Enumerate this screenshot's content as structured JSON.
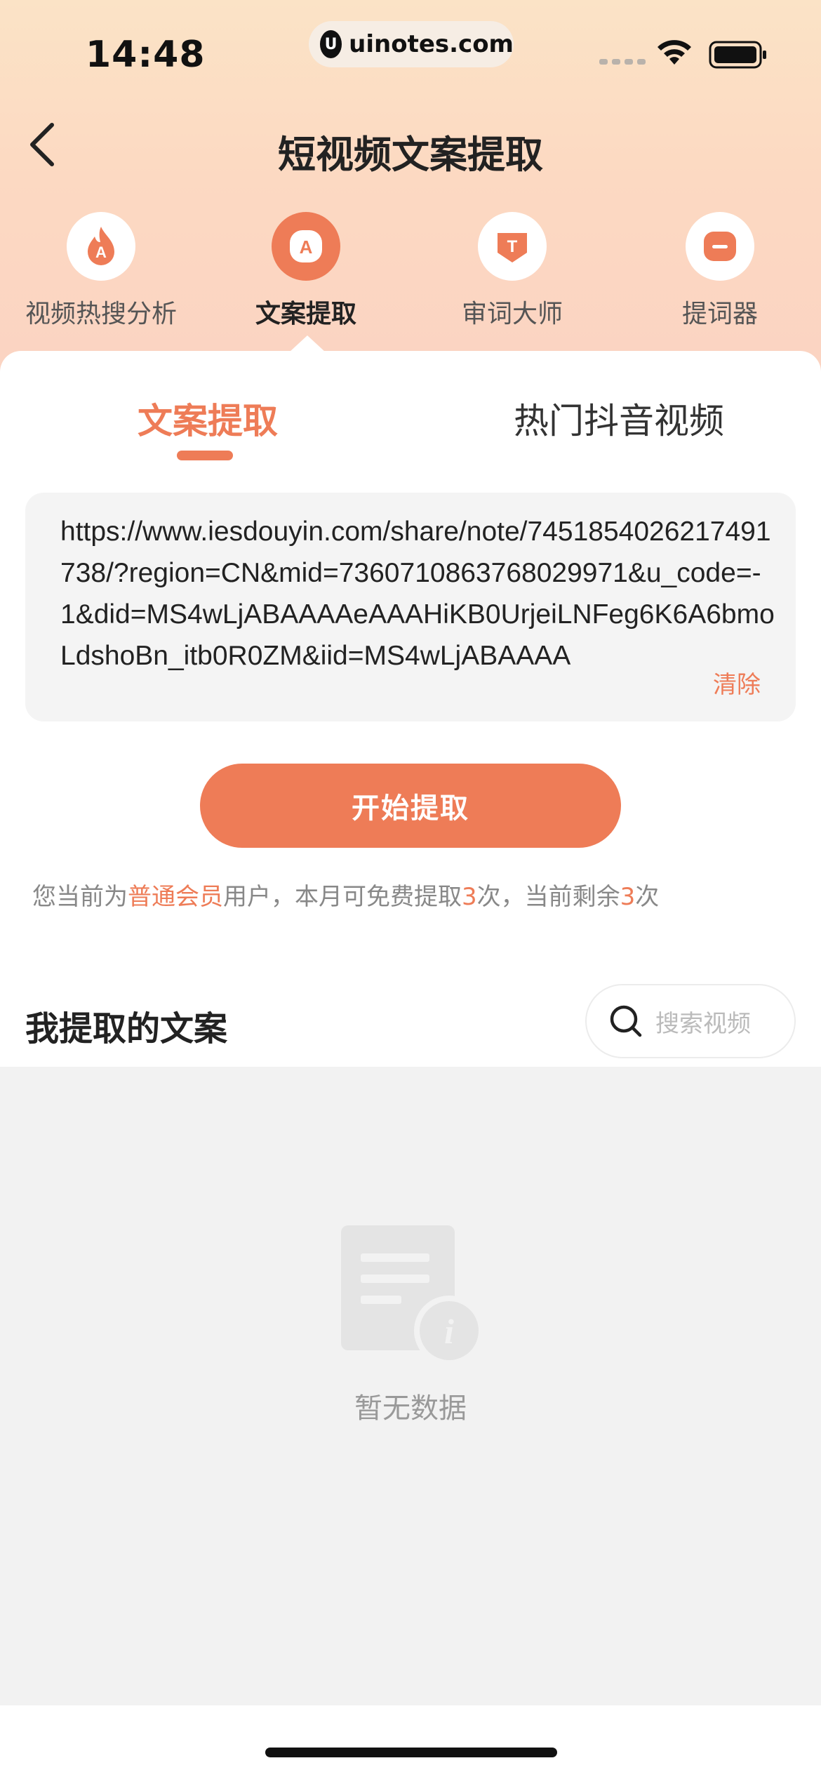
{
  "status_bar": {
    "time": "14:48",
    "url": "uinotes.com",
    "url_logo": "U"
  },
  "nav": {
    "title": "短视频文案提取",
    "back_icon": "chevron-left-icon"
  },
  "categories": [
    {
      "label": "视频热搜分析",
      "icon": "flame-icon"
    },
    {
      "label": "文案提取",
      "icon": "a-badge-icon",
      "active": true
    },
    {
      "label": "审词大师",
      "icon": "t-badge-icon"
    },
    {
      "label": "提词器",
      "icon": "prompter-icon"
    }
  ],
  "tabs": [
    {
      "label": "文案提取",
      "active": true
    },
    {
      "label": "热门抖音视频",
      "active": false
    }
  ],
  "input": {
    "value": "https://www.iesdouyin.com/share/note/7451854026217491738/?region=CN&mid=7360710863768029971&u_code=-1&did=MS4wLjABAAAAeAAAHiKB0UrjeiLNFeg6K6A6bmoLdshoBn_itb0R0ZM&iid=MS4wLjABAAAA",
    "clear_label": "清除"
  },
  "start_button": {
    "label": "开始提取"
  },
  "quota": {
    "prefix": "您当前为",
    "member_type": "普通会员",
    "middle": "用户，本月可免费提取",
    "free_count": "3",
    "middle2": "次，当前剩余",
    "remaining": "3",
    "suffix": "次"
  },
  "history": {
    "title": "我提取的文案",
    "search_placeholder": "搜索视频",
    "empty_text": "暂无数据"
  },
  "colors": {
    "accent": "#ee7c57",
    "header_gradient_top": "#fbe3c6",
    "header_gradient_bottom": "#fbd3c2"
  }
}
